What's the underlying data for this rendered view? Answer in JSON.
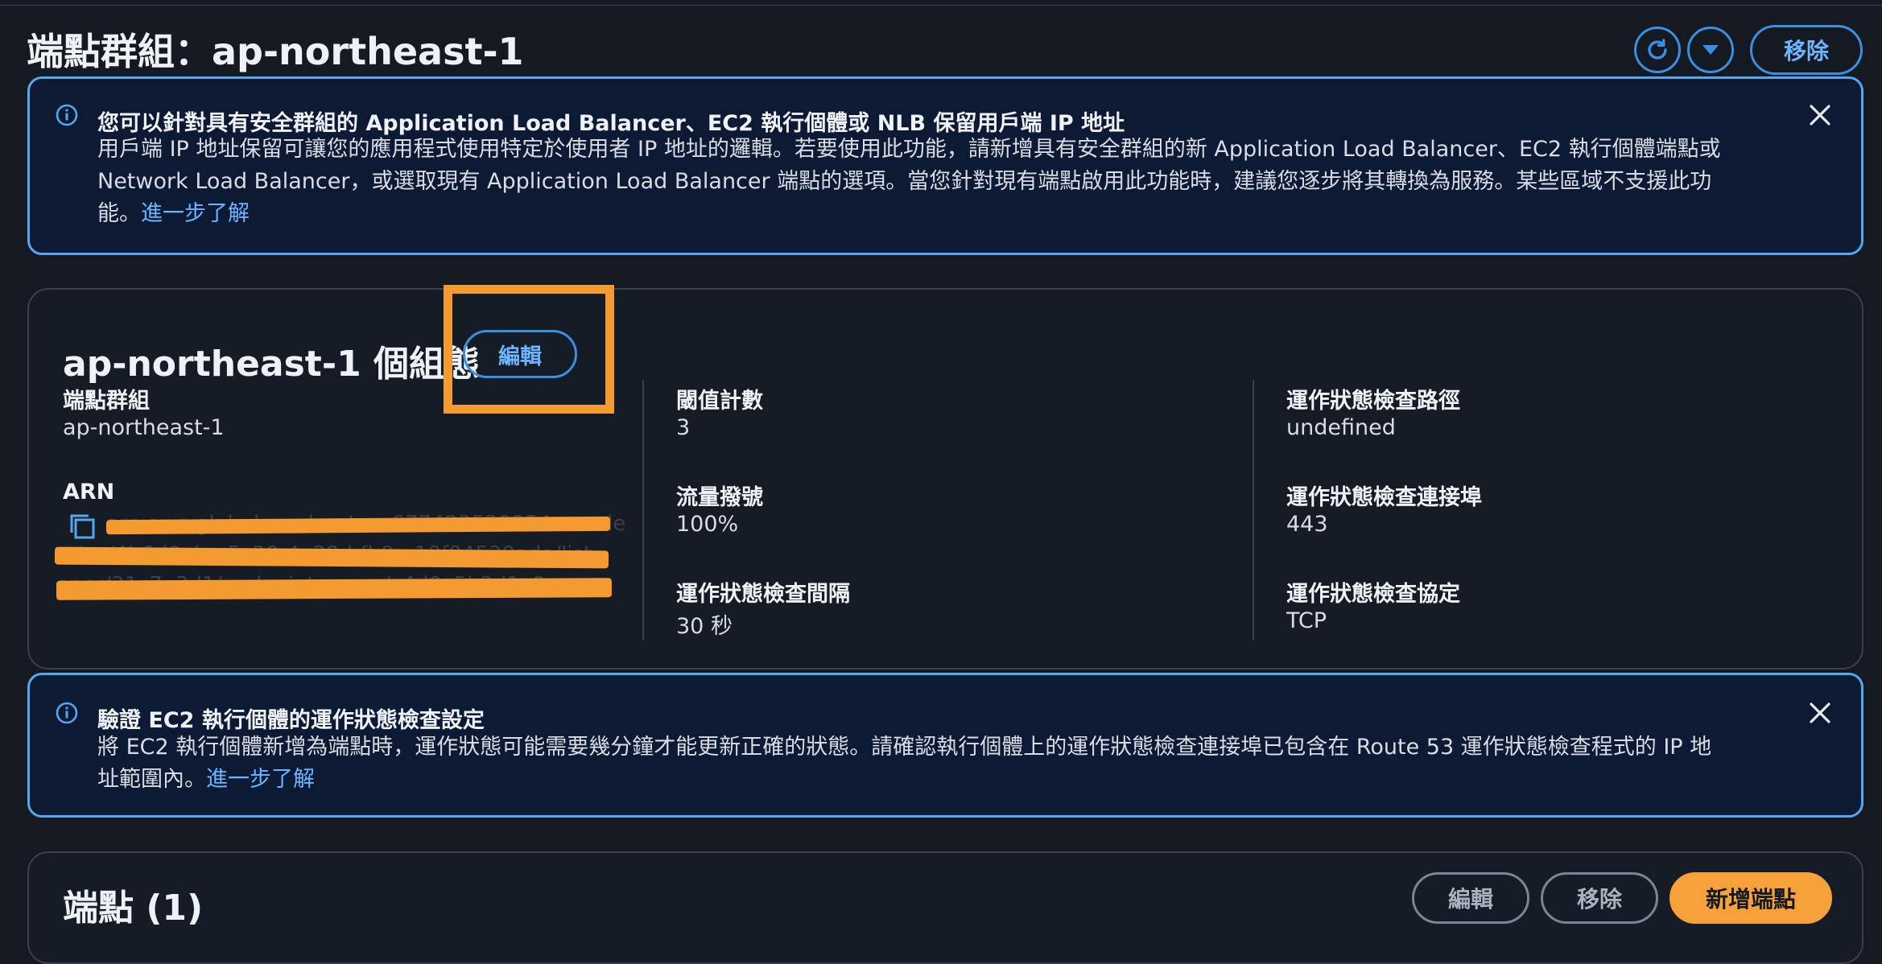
{
  "header": {
    "title": "端點群組：ap-northeast-1",
    "refresh_icon": "refresh-icon",
    "dropdown_icon": "caret-down-icon",
    "remove_label": "移除"
  },
  "alert_ip": {
    "title": "您可以針對具有安全群組的 Application Load Balancer、EC2 執行個體或 NLB 保留用戶端 IP 地址",
    "body_line1": "用戶端 IP 地址保留可讓您的應用程式使用特定於使用者 IP 地址的邏輯。若要使用此功能，請新增具有安全群組的新 Application Load Balancer、EC2 執行個體端點或",
    "body_line2": "Network Load Balancer，或選取現有 Application Load Balancer 端點的選項。當您針對現有端點啟用此功能時，建議您逐步將其轉換為服務。某些區域不支援此功",
    "body_line3": "能。",
    "link": "進一步了解",
    "icon": "info-icon",
    "close_icon": "close-icon"
  },
  "config": {
    "title": "ap-northeast-1 個組態",
    "edit_label": "編輯",
    "endpoint_group_label": "端點群組",
    "endpoint_group_value": "ap-northeast-1",
    "arn_label": "ARN",
    "arn_line1": "arn:aws:globalaccelerator::677423520954:accele",
    "arn_line2": "rator/4b6d0abe-5c20-4a29-bfb0-a10f04530ade/list",
    "arn_line3": "ener/31c7e3d1/endpoint-group/c4d0c5b3d1a2",
    "copy_icon": "copy-icon",
    "threshold_label": "閾值計數",
    "threshold_value": "3",
    "traffic_dial_label": "流量撥號",
    "traffic_dial_value": "100%",
    "interval_label": "運作狀態檢查間隔",
    "interval_value": "30 秒",
    "hc_path_label": "運作狀態檢查路徑",
    "hc_path_value": "undefined",
    "hc_port_label": "運作狀態檢查連接埠",
    "hc_port_value": "443",
    "hc_protocol_label": "運作狀態檢查協定",
    "hc_protocol_value": "TCP"
  },
  "alert_hc": {
    "title": "驗證 EC2 執行個體的運作狀態檢查設定",
    "body_line1": "將 EC2 執行個體新增為端點時，運作狀態可能需要幾分鐘才能更新正確的狀態。請確認執行個體上的運作狀態檢查連接埠已包含在 Route 53 運作狀態檢查程式的 IP 地",
    "body_line2": "址範圍內。",
    "link": "進一步了解",
    "icon": "info-icon",
    "close_icon": "close-icon"
  },
  "endpoints": {
    "title": "端點 (1)",
    "edit_label": "編輯",
    "remove_label": "移除",
    "add_label": "新增端點"
  },
  "colors": {
    "background": "#151a22",
    "accent_blue": "#3b8fe0",
    "highlight_orange": "#f39a31"
  }
}
